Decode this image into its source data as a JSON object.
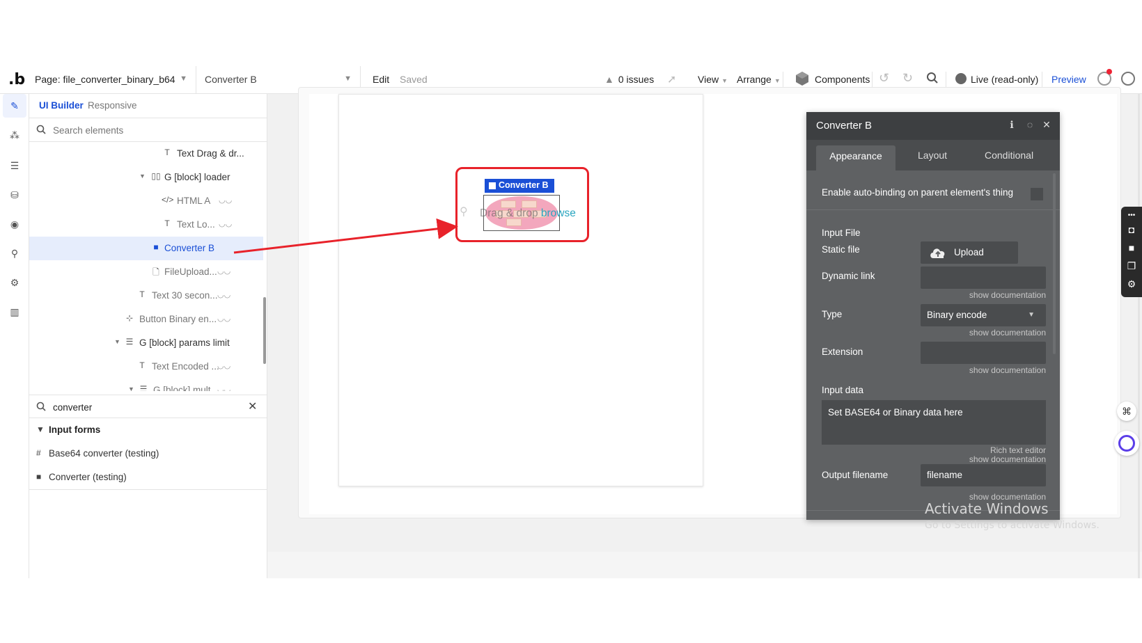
{
  "topbar": {
    "page_label": "Page: file_converter_binary_b64",
    "element_label": "Converter B",
    "edit": "Edit",
    "saved": "Saved",
    "issues": "0 issues",
    "view": "View",
    "arrange": "Arrange",
    "components": "Components",
    "live": "Live (read-only)",
    "preview": "Preview"
  },
  "panel": {
    "tab_ui_builder": "UI Builder",
    "tab_responsive": "Responsive",
    "search_placeholder": "Search elements",
    "tree": [
      {
        "label": "Text Drag & dr...",
        "icon": "T"
      },
      {
        "label": "G [block] loader",
        "icon": "columns-icon"
      },
      {
        "label": "HTML A",
        "icon": "code-icon"
      },
      {
        "label": "Text Lo...",
        "icon": "T"
      },
      {
        "label": "Converter B",
        "icon": "square-icon"
      },
      {
        "label": "FileUpload...",
        "icon": "file-icon"
      },
      {
        "label": "Text 30 secon...",
        "icon": "T"
      },
      {
        "label": "Button Binary en...",
        "icon": "button-icon"
      },
      {
        "label": "G [block] params limit",
        "icon": "rows-icon"
      },
      {
        "label": "Text Encoded ...",
        "icon": "T"
      },
      {
        "label": "G [block] mult...",
        "icon": "rows-icon"
      }
    ],
    "search2_value": "converter",
    "results": {
      "group": "Input forms",
      "items": [
        "Base64 converter (testing)",
        "Converter (testing)"
      ]
    }
  },
  "canvas": {
    "tag_label": "Converter B",
    "drag_text": "Drag & drop ",
    "browse_text": "browse"
  },
  "editor": {
    "title": "Converter B",
    "tabs": [
      "Appearance",
      "Layout",
      "Conditional"
    ],
    "auto_binding": "Enable auto-binding on parent element's thing",
    "input_file": "Input File",
    "static_file": "Static file",
    "upload": "Upload",
    "dynamic_link": "Dynamic link",
    "show_documentation": "show documentation",
    "type_label": "Type",
    "type_value": "Binary encode",
    "extension": "Extension",
    "input_data": "Input data",
    "input_data_value": "Set BASE64 or Binary data here",
    "rich_text_editor": "Rich text editor",
    "output_filename": "Output filename",
    "output_filename_value": "filename"
  },
  "watermark": {
    "line1": "Activate Windows",
    "line2": "Go to Settings to activate Windows."
  },
  "colors": {
    "accent": "#1a4fd6",
    "highlight": "#e8222a",
    "editor_bg": "#5f6163"
  }
}
